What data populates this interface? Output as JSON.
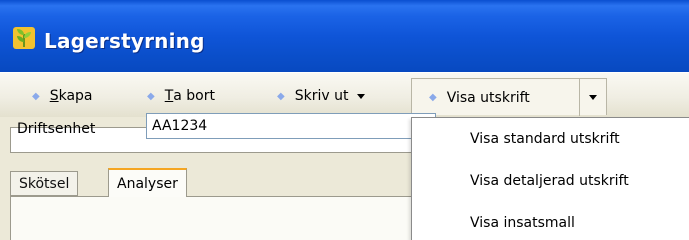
{
  "window": {
    "title": "Lagerstyrning",
    "icon": "wheat-leaf-icon"
  },
  "toolbar": {
    "items": [
      {
        "label": "Skapa",
        "mnemonic": "S",
        "rest": "kapa"
      },
      {
        "label": "Ta bort",
        "mnemonic": "T",
        "rest": "a bort"
      },
      {
        "label": "Skriv ut",
        "mnemonic": "",
        "rest": "Skriv ut"
      },
      {
        "label": "Visa utskrift"
      }
    ]
  },
  "tabs": [
    {
      "label": "Skötsel",
      "active": false
    },
    {
      "label": "Analyser",
      "active": true
    }
  ],
  "form": {
    "driftsenhet_label": "Driftsenhet",
    "driftsenhet_value": "AA1234"
  },
  "menu": {
    "items": [
      {
        "label": "Visa standard utskrift"
      },
      {
        "label": "Visa detaljerad utskrift"
      },
      {
        "label": "Visa insatsmall"
      }
    ]
  },
  "colors": {
    "titlebar": "#0a4ec9",
    "active_tab_accent": "#f5a623",
    "toolbar_bullet": "#8aa9ea"
  }
}
